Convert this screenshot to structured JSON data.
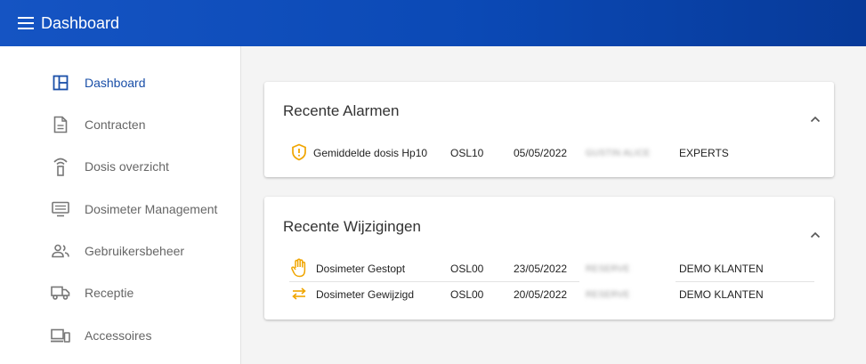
{
  "app": {
    "title": "Dashboard"
  },
  "colors": {
    "topbar": "#0b49b5",
    "active": "#1a4fa8",
    "accent": "#f0a500"
  },
  "sidebar": {
    "items": [
      {
        "label": "Dashboard",
        "icon": "dashboard-icon",
        "active": true
      },
      {
        "label": "Contracten",
        "icon": "document-icon"
      },
      {
        "label": "Dosis overzicht",
        "icon": "sensor-icon"
      },
      {
        "label": "Dosimeter Management",
        "icon": "monitor-icon"
      },
      {
        "label": "Gebruikersbeheer",
        "icon": "users-icon"
      },
      {
        "label": "Receptie",
        "icon": "truck-icon"
      },
      {
        "label": "Accessoires",
        "icon": "devices-icon"
      }
    ]
  },
  "alarms": {
    "title": "Recente Alarmen",
    "rows": [
      {
        "icon": "shield-alert-icon",
        "type": "Gemiddelde dosis Hp10",
        "code": "OSL10",
        "date": "05/05/2022",
        "name": "GUSTIN ALICE",
        "client": "EXPERTS"
      }
    ]
  },
  "changes": {
    "title": "Recente Wijzigingen",
    "rows": [
      {
        "icon": "hand-stop-icon",
        "type": "Dosimeter Gestopt",
        "code": "OSL00",
        "date": "23/05/2022",
        "name": "RESERVE",
        "client": "DEMO KLANTEN"
      },
      {
        "icon": "swap-arrows-icon",
        "type": "Dosimeter Gewijzigd",
        "code": "OSL00",
        "date": "20/05/2022",
        "name": "RESERVE",
        "client": "DEMO KLANTEN"
      }
    ]
  }
}
